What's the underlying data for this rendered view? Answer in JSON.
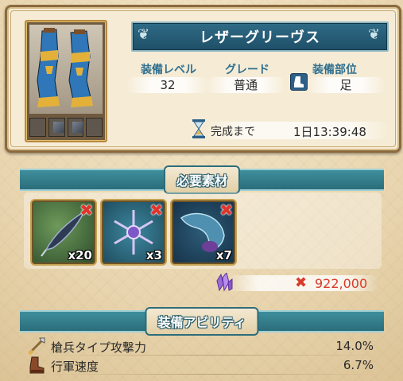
{
  "item": {
    "name": "レザーグリーヴス",
    "labels": {
      "level": "装備レベル",
      "grade": "グレード",
      "slot": "装備部位"
    },
    "values": {
      "level": "32",
      "grade": "普通",
      "slot": "足"
    },
    "completion_label": "完成まで",
    "completion_time": "1日13:39:48"
  },
  "materials_section": {
    "title": "必要素材",
    "items": [
      {
        "icon": "quill-feather-icon",
        "quantity": "x20",
        "insufficient": true
      },
      {
        "icon": "snow-crystal-icon",
        "quantity": "x3",
        "insufficient": true
      },
      {
        "icon": "blue-horn-icon",
        "quantity": "x7",
        "insufficient": true
      }
    ],
    "cost": {
      "icon": "purple-crystal-icon",
      "value": "922,000",
      "insufficient": true
    }
  },
  "abilities_section": {
    "title": "装備アビリティ",
    "items": [
      {
        "icon": "spear-icon",
        "name": "槍兵タイプ攻撃力",
        "value": "14.0%"
      },
      {
        "icon": "boot-icon",
        "name": "行軍速度",
        "value": "6.7%"
      }
    ]
  },
  "colors": {
    "banner": "#2f6b86",
    "label_blue": "#2f6f8f",
    "insufficient_red": "#d93b2b",
    "section_teal": "#2b6d7b"
  }
}
